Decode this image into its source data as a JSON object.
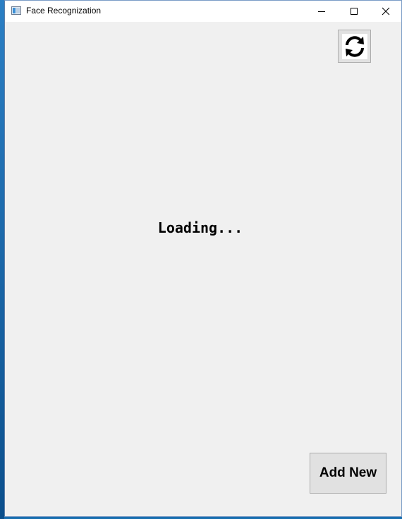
{
  "window": {
    "title": "Face Recognization",
    "controls": {
      "minimize_icon": "minimize-icon",
      "maximize_icon": "maximize-icon",
      "close_icon": "close-icon"
    }
  },
  "main": {
    "refresh_icon": "refresh-icon",
    "status_text": "Loading...",
    "add_new_label": "Add New"
  },
  "colors": {
    "window_background": "#f0f0f0",
    "titlebar_background": "#ffffff",
    "button_background": "#e1e1e1",
    "button_border": "#adadad"
  }
}
